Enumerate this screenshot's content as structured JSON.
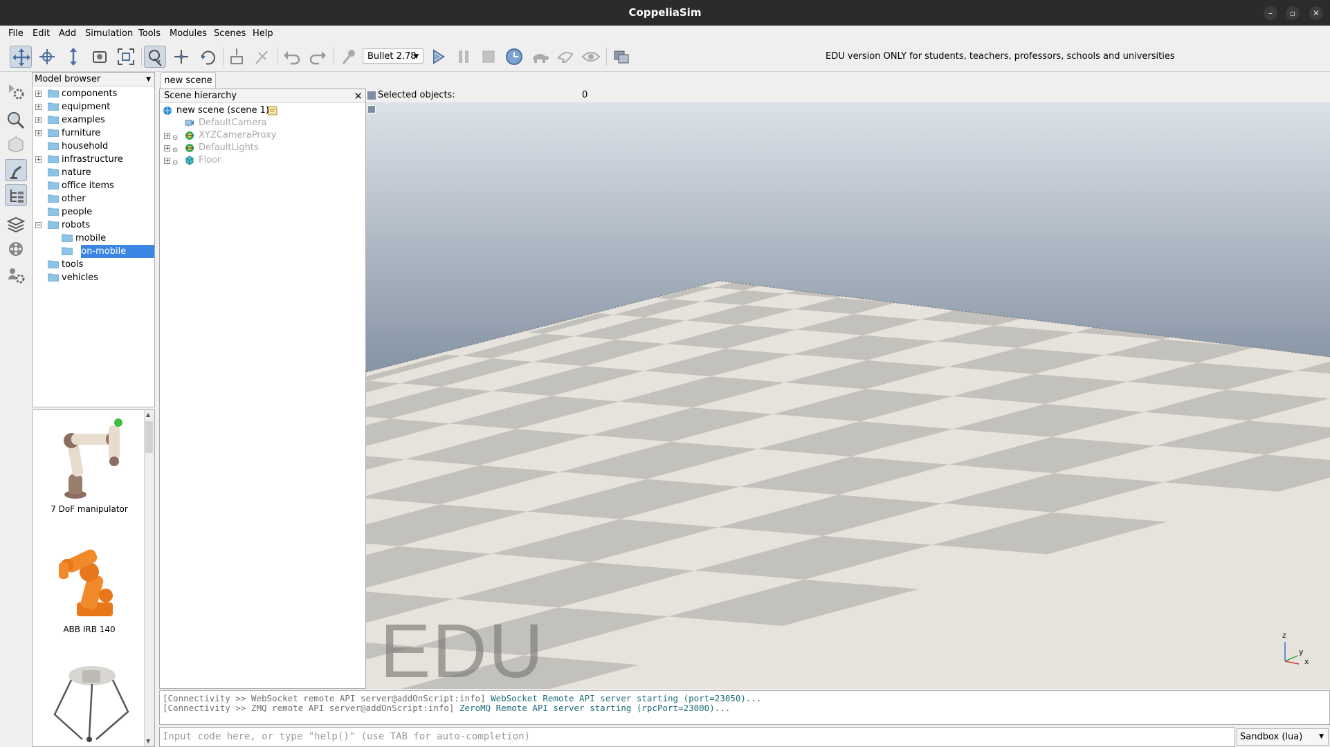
{
  "window": {
    "title": "CoppeliaSim",
    "controls": [
      "–",
      "▫",
      "✕"
    ]
  },
  "menubar": [
    "File",
    "Edit",
    "Add",
    "Simulation",
    "Tools",
    "Modules",
    "Scenes",
    "Help"
  ],
  "toolbar": {
    "engine": "Bullet 2.78",
    "edu_notice": "EDU version ONLY for students, teachers, professors, schools and universities"
  },
  "model_browser": {
    "header": "Model browser",
    "folders": [
      {
        "label": "components",
        "expander": "+"
      },
      {
        "label": "equipment",
        "expander": "+"
      },
      {
        "label": "examples",
        "expander": "+"
      },
      {
        "label": "furniture",
        "expander": "+"
      },
      {
        "label": "household",
        "expander": ""
      },
      {
        "label": "infrastructure",
        "expander": "+"
      },
      {
        "label": "nature",
        "expander": ""
      },
      {
        "label": "office items",
        "expander": ""
      },
      {
        "label": "other",
        "expander": ""
      },
      {
        "label": "people",
        "expander": ""
      },
      {
        "label": "robots",
        "expander": "−"
      },
      {
        "label": "mobile",
        "expander": ""
      },
      {
        "label": "non-mobile",
        "expander": ""
      },
      {
        "label": "tools",
        "expander": ""
      },
      {
        "label": "vehicles",
        "expander": ""
      }
    ],
    "selected": "non-mobile",
    "thumbnails": [
      "7 DoF manipulator",
      "ABB IRB 140",
      ""
    ]
  },
  "scene_tab": "new scene",
  "scene_hierarchy": {
    "header": "Scene hierarchy",
    "root": "new scene (scene 1)",
    "objects": [
      "DefaultCamera",
      "XYZCameraProxy",
      "DefaultLights",
      "Floor"
    ]
  },
  "viewport": {
    "selected_label": "Selected objects:",
    "selected_count": "0",
    "watermark": "EDU",
    "axes": {
      "z": "z",
      "y": "y",
      "x": "x"
    }
  },
  "console": {
    "lines": [
      {
        "prefix": "[Connectivity >> WebSocket remote API server@addOnScript:info]",
        "message": "WebSocket Remote API server starting (port=23050)..."
      },
      {
        "prefix": "[Connectivity >> ZMQ remote API server@addOnScript:info]",
        "message": "ZeroMQ Remote API server starting (rpcPort=23000)..."
      }
    ],
    "input_placeholder": "Input code here, or type \"help()\" (use TAB for auto-completion)",
    "interpreter": "Sandbox (lua)"
  },
  "colors": {
    "selection": "#3b86e5",
    "titlebar": "#2b2b2b",
    "console_teal": "#1b6a78"
  }
}
